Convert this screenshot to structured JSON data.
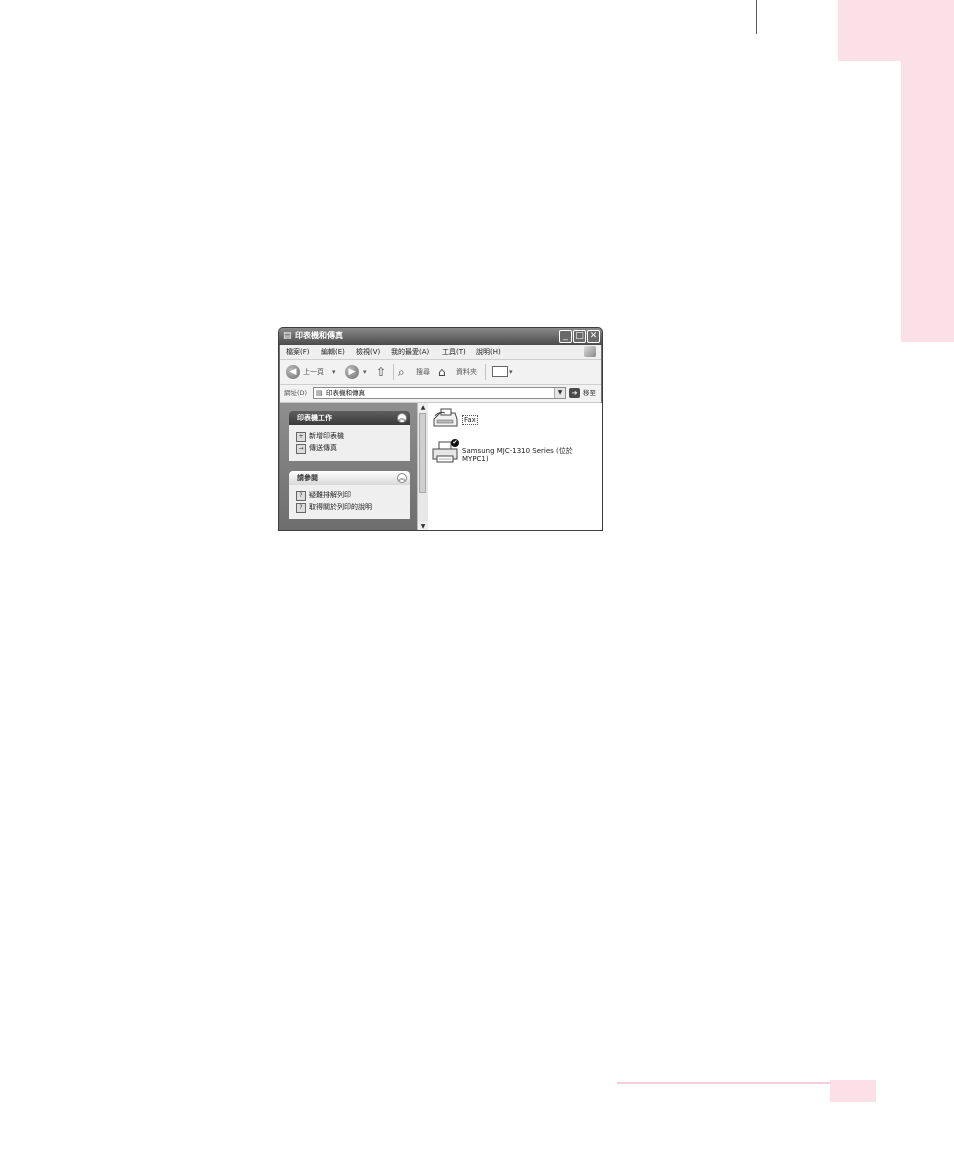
{
  "window": {
    "title": "印表機和傳真",
    "icon": "printer-folder-icon"
  },
  "menubar": {
    "items": [
      "檔案(F)",
      "編輯(E)",
      "檢視(V)",
      "我的最愛(A)",
      "工具(T)",
      "說明(H)"
    ]
  },
  "toolbar": {
    "back_label": "上一頁",
    "search_label": "搜尋",
    "folders_label": "資料夾"
  },
  "address": {
    "label": "網址(D)",
    "value": "印表機和傳真",
    "go_label": "移至"
  },
  "left_pane": {
    "printer_tasks": {
      "title": "印表機工作",
      "items": [
        "新增印表機",
        "傳送傳真"
      ]
    },
    "see_also": {
      "title": "請參閱",
      "items": [
        "疑難排解列印",
        "取得關於列印的說明"
      ]
    }
  },
  "printers": [
    {
      "name": "Fax"
    },
    {
      "name": "Samsung MJC-1310 Series (位於 MYPC1)",
      "default": true
    }
  ],
  "colors": {
    "page_accent": "#fbe0e8",
    "window_frame": "#6f6f6f"
  }
}
